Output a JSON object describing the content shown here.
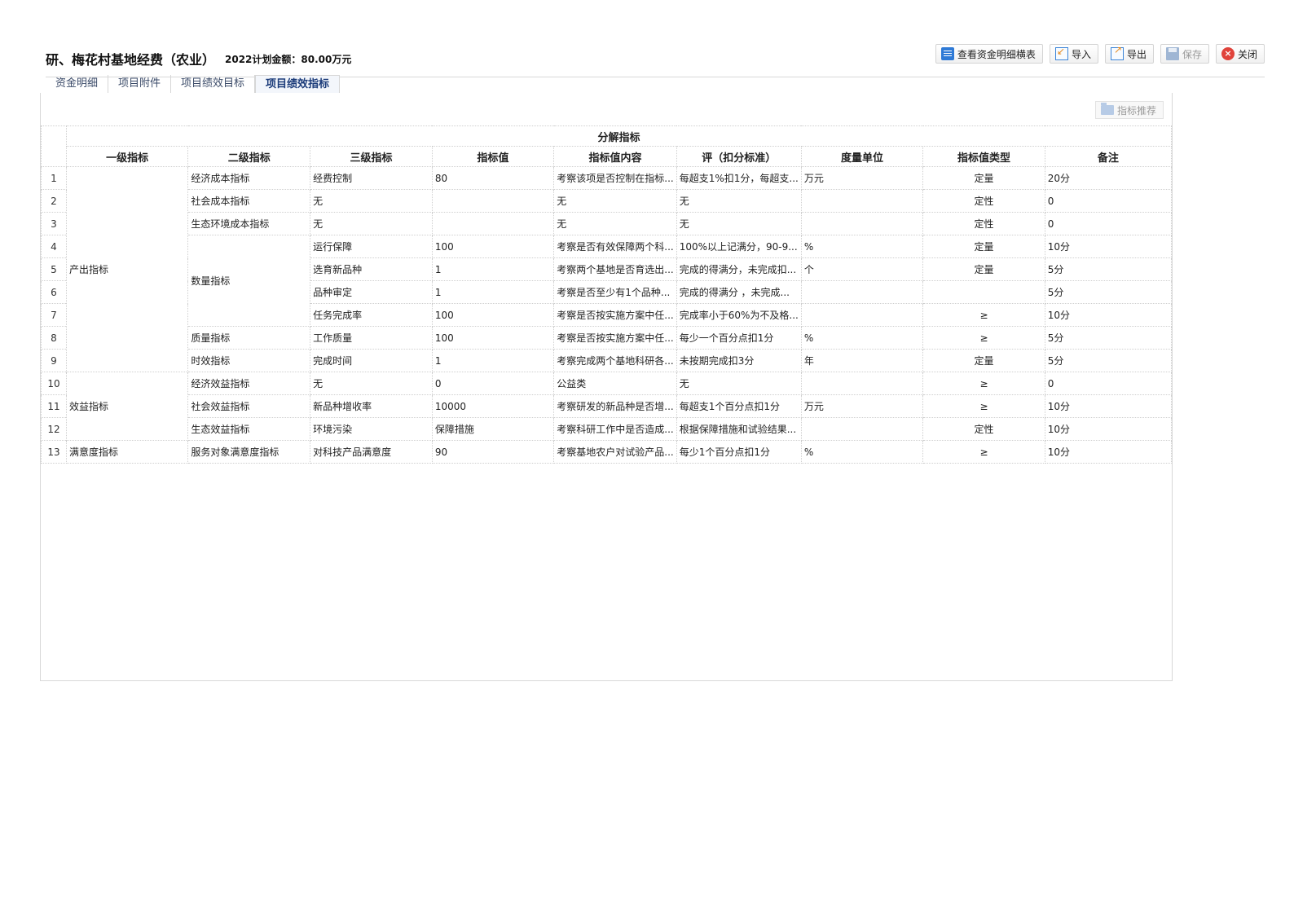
{
  "header": {
    "title": "研、梅花村基地经费（农业）",
    "sub": "2022计划金额：80.00万元"
  },
  "toolbar": {
    "view": "查看资金明细横表",
    "import": "导入",
    "export": "导出",
    "save": "保存",
    "close": "关闭"
  },
  "tabs": [
    "资金明细",
    "项目附件",
    "项目绩效目标",
    "项目绩效指标"
  ],
  "recommend": "指标推荐",
  "table": {
    "group_header": "分解指标",
    "columns": [
      "一级指标",
      "二级指标",
      "三级指标",
      "指标值",
      "指标值内容",
      "评（扣分标准）",
      "度量单位",
      "指标值类型",
      "备注"
    ],
    "level1": [
      "产出指标",
      "效益指标",
      "满意度指标"
    ],
    "level2": [
      "经济成本指标",
      "社会成本指标",
      "生态环境成本指标",
      "数量指标",
      "质量指标",
      "时效指标",
      "经济效益指标",
      "社会效益指标",
      "生态效益指标",
      "服务对象满意度指标"
    ],
    "rows": [
      {
        "n": "1",
        "l3": "经费控制",
        "val": "80",
        "content": "考察该项是否控制在指标...",
        "score": "每超支1%扣1分，每超支...",
        "unit": "万元",
        "type": "定量",
        "note": "20分"
      },
      {
        "n": "2",
        "l3": "无",
        "val": "",
        "content": "无",
        "score": "无",
        "unit": "",
        "type": "定性",
        "note": "0"
      },
      {
        "n": "3",
        "l3": "无",
        "val": "",
        "content": "无",
        "score": "无",
        "unit": "",
        "type": "定性",
        "note": "0"
      },
      {
        "n": "4",
        "l3": "运行保障",
        "val": "100",
        "content": "考察是否有效保障两个科...",
        "score": "100%以上记满分，90-9...",
        "unit": "%",
        "type": "定量",
        "note": "10分"
      },
      {
        "n": "5",
        "l3": "选育新品种",
        "val": "1",
        "content": "考察两个基地是否育选出...",
        "score": "完成的得满分，未完成扣...",
        "unit": "个",
        "type": "定量",
        "note": "5分"
      },
      {
        "n": "6",
        "l3": "品种审定",
        "val": "1",
        "content": "考察是否至少有1个品种...",
        "score": "完成的得满分 ，未完成...",
        "unit": "",
        "type": "",
        "note": "5分"
      },
      {
        "n": "7",
        "l3": "任务完成率",
        "val": "100",
        "content": "考察是否按实施方案中任...",
        "score": "完成率小于60%为不及格...",
        "unit": "",
        "type": "≥",
        "note": "10分"
      },
      {
        "n": "8",
        "l3": "工作质量",
        "val": "100",
        "content": "考察是否按实施方案中任...",
        "score": "每少一个百分点扣1分",
        "unit": "%",
        "type": "≥",
        "note": "5分"
      },
      {
        "n": "9",
        "l3": "完成时间",
        "val": "1",
        "content": "考察完成两个基地科研各...",
        "score": "未按期完成扣3分",
        "unit": "年",
        "type": "定量",
        "note": "5分"
      },
      {
        "n": "10",
        "l3": "无",
        "val": "0",
        "content": "公益类",
        "score": "无",
        "unit": "",
        "type": "≥",
        "note": "0"
      },
      {
        "n": "11",
        "l3": "新品种增收率",
        "val": "10000",
        "content": "考察研发的新品种是否增...",
        "score": "每超支1个百分点扣1分",
        "unit": "万元",
        "type": "≥",
        "note": "10分"
      },
      {
        "n": "12",
        "l3": "环境污染",
        "val": "保障措施",
        "content": "考察科研工作中是否造成...",
        "score": "根据保障措施和试验结果...",
        "unit": "",
        "type": "定性",
        "note": "10分"
      },
      {
        "n": "13",
        "l3": "对科技产品满意度",
        "val": "90",
        "content": "考察基地农户对试验产品...",
        "score": "每少1个百分点扣1分",
        "unit": "%",
        "type": "≥",
        "note": "10分"
      }
    ]
  }
}
